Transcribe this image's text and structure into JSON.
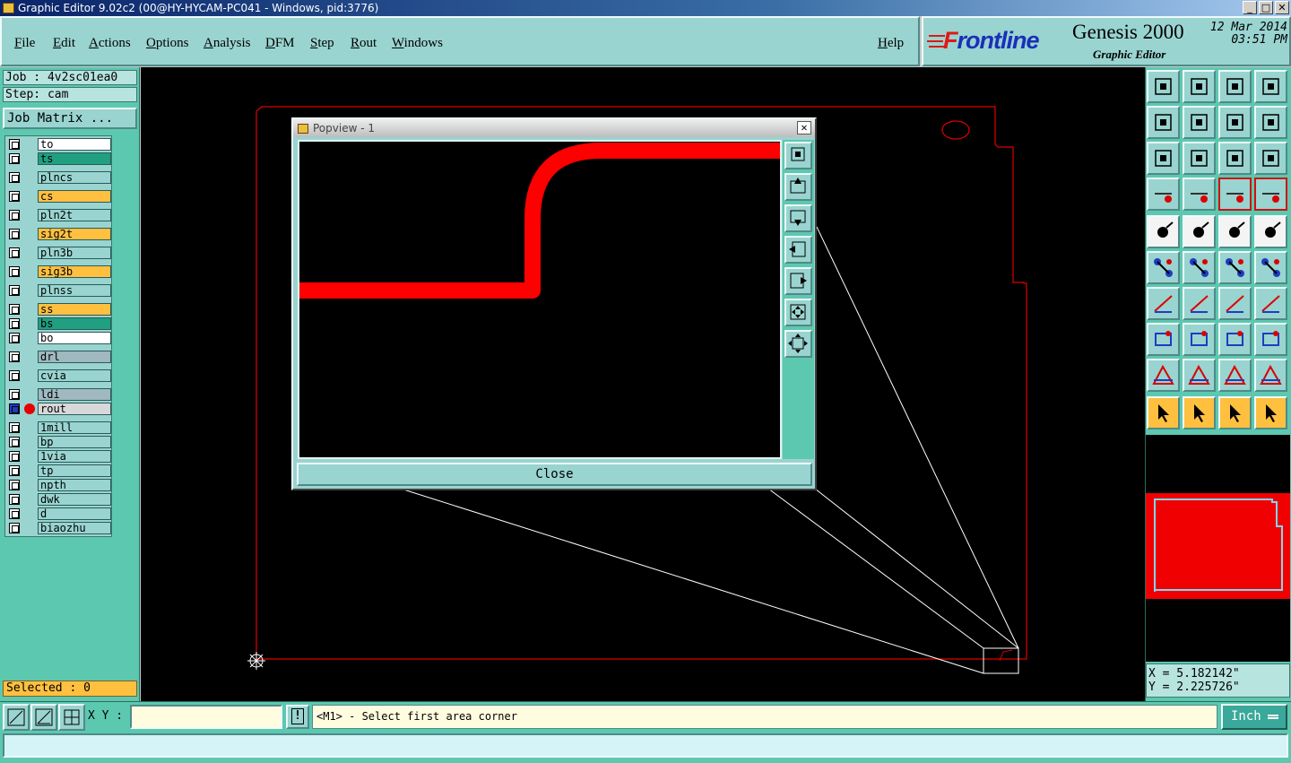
{
  "window": {
    "title": "Graphic Editor 9.02c2 (00@HY-HYCAM-PC041 - Windows, pid:3776)"
  },
  "menu": {
    "items": [
      "File",
      "Edit",
      "Actions",
      "Options",
      "Analysis",
      "DFM",
      "Step",
      "Rout",
      "Windows"
    ],
    "help": "Help"
  },
  "logo": {
    "brand_prefix": "F",
    "brand_rest": "rontline",
    "product": "Genesis 2000",
    "subtitle": "Graphic Editor",
    "date": "12 Mar 2014",
    "time": "03:51 PM"
  },
  "job": {
    "job_label": "Job : 4v2sc01ea0",
    "step_label": "Step: cam",
    "matrix_button": "Job Matrix ..."
  },
  "layers": [
    {
      "name": "to",
      "color": "#ffffff"
    },
    {
      "name": "ts",
      "color": "#20a080"
    },
    {
      "name": "plncs",
      "color": "#99d4d0"
    },
    {
      "name": "cs",
      "color": "#ffc040"
    },
    {
      "name": "pln2t",
      "color": "#99d4d0"
    },
    {
      "name": "sig2t",
      "color": "#ffc040"
    },
    {
      "name": "pln3b",
      "color": "#99d4d0"
    },
    {
      "name": "sig3b",
      "color": "#ffc040"
    },
    {
      "name": "plnss",
      "color": "#99d4d0"
    },
    {
      "name": "ss",
      "color": "#ffc040"
    },
    {
      "name": "bs",
      "color": "#20a080"
    },
    {
      "name": "bo",
      "color": "#ffffff"
    },
    {
      "name": "drl",
      "color": "#a0b8c0"
    },
    {
      "name": "cvia",
      "color": "#99d4d0"
    },
    {
      "name": "ldi",
      "color": "#a0b8c0"
    },
    {
      "name": "rout",
      "color": "#d8d8d8",
      "active": true
    },
    {
      "name": "1mill",
      "color": "#99d4d0"
    },
    {
      "name": "bp",
      "color": "#99d4d0"
    },
    {
      "name": "1via",
      "color": "#99d4d0"
    },
    {
      "name": "tp",
      "color": "#99d4d0"
    },
    {
      "name": "npth",
      "color": "#99d4d0"
    },
    {
      "name": "dwk",
      "color": "#99d4d0"
    },
    {
      "name": "d",
      "color": "#99d4d0"
    },
    {
      "name": "biaozhu",
      "color": "#99d4d0"
    }
  ],
  "selected": "Selected : 0",
  "popview": {
    "title": "Popview - 1",
    "close_label": "Close",
    "close_x": "✕"
  },
  "coords": {
    "x": "X = 5.182142\"",
    "y": "Y = 2.225726\""
  },
  "command": {
    "xy_label": "X Y :",
    "xy_value": "",
    "prompt": "<M1> - Select first area corner",
    "excl": "!",
    "unit": "Inch"
  },
  "colors": {
    "panel": "#5cc8b0",
    "button": "#99d4d0",
    "rout": "#e80000",
    "accent_yellow": "#ffc040"
  }
}
